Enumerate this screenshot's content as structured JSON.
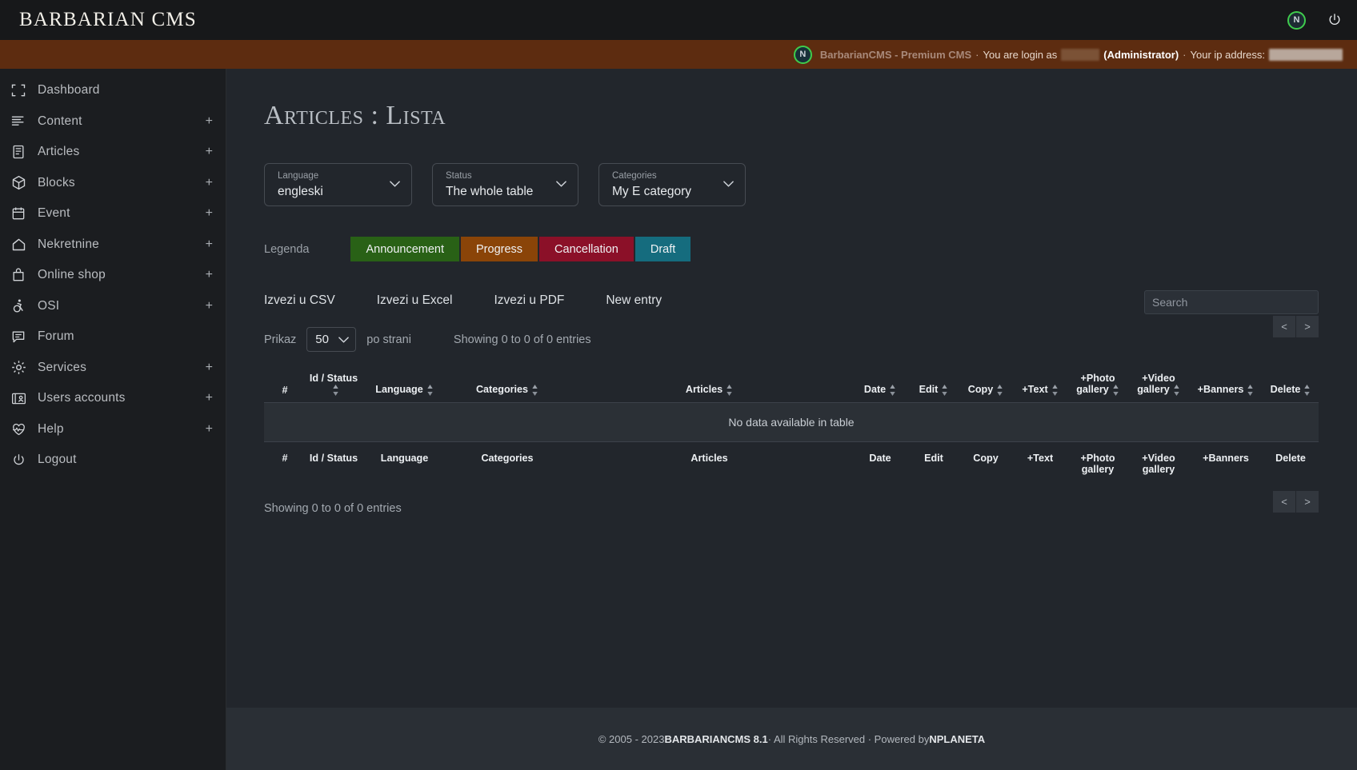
{
  "topbar": {
    "logo": "BARBARIAN CMS",
    "notification_badge": "N",
    "notification_icon_name": "notification-badge-icon",
    "power_icon_name": "power-icon"
  },
  "noticebar": {
    "badge": "N",
    "brand": "BarbarianCMS - Premium CMS",
    "sep1": "·",
    "login_text": "You are login as",
    "username_redacted": "",
    "role": "(Administrator)",
    "sep2": "·",
    "ip_text": "Your ip address:",
    "ip_redacted": "",
    "background_color": "#5d2c10"
  },
  "sidebar": {
    "items": [
      {
        "label": "Dashboard",
        "icon": "dashboard-icon",
        "expandable": false
      },
      {
        "label": "Content",
        "icon": "content-lines-icon",
        "expandable": true
      },
      {
        "label": "Articles",
        "icon": "article-doc-icon",
        "expandable": true
      },
      {
        "label": "Blocks",
        "icon": "cube-icon",
        "expandable": true
      },
      {
        "label": "Event",
        "icon": "calendar-icon",
        "expandable": true
      },
      {
        "label": "Nekretnine",
        "icon": "house-icon",
        "expandable": true
      },
      {
        "label": "Online shop",
        "icon": "shopping-bag-icon",
        "expandable": true
      },
      {
        "label": "OSI",
        "icon": "accessibility-icon",
        "expandable": true
      },
      {
        "label": "Forum",
        "icon": "chat-bubble-icon",
        "expandable": false
      },
      {
        "label": "Services",
        "icon": "gear-icon",
        "expandable": true
      },
      {
        "label": "Users accounts",
        "icon": "id-card-icon",
        "expandable": true
      },
      {
        "label": "Help",
        "icon": "heart-pulse-icon",
        "expandable": true
      },
      {
        "label": "Logout",
        "icon": "power-icon",
        "expandable": false
      }
    ],
    "expand_symbol": "+"
  },
  "main": {
    "page_title": "Articles : Lista",
    "filters": [
      {
        "label": "Language",
        "value": "engleski"
      },
      {
        "label": "Status",
        "value": "The whole table"
      },
      {
        "label": "Categories",
        "value": "My E category"
      }
    ],
    "legend": {
      "label": "Legenda",
      "items": [
        {
          "label": "Announcement",
          "color": "#296116"
        },
        {
          "label": "Progress",
          "color": "#8a4408"
        },
        {
          "label": "Cancellation",
          "color": "#8b1028"
        },
        {
          "label": "Draft",
          "color": "#156c7e"
        }
      ]
    },
    "export_buttons": [
      "Izvezi u CSV",
      "Izvezi u Excel",
      "Izvezi u PDF",
      "New entry"
    ],
    "search": {
      "placeholder": "Search",
      "value": ""
    },
    "table_controls": {
      "prikaz_label": "Prikaz",
      "page_size": "50",
      "po_strani_label": "po strani",
      "showing_text": "Showing 0 to 0 of 0 entries",
      "prev_label": "<",
      "next_label": ">"
    },
    "table": {
      "columns": [
        {
          "label": "#",
          "sortable": false
        },
        {
          "label": "Id / Status",
          "sortable": true
        },
        {
          "label": "Language",
          "sortable": true
        },
        {
          "label": "Categories",
          "sortable": true
        },
        {
          "label": "Articles",
          "sortable": true
        },
        {
          "label": "Date",
          "sortable": true
        },
        {
          "label": "Edit",
          "sortable": true
        },
        {
          "label": "Copy",
          "sortable": true
        },
        {
          "label": "+Text",
          "sortable": true
        },
        {
          "label": "+Photo gallery",
          "sortable": true
        },
        {
          "label": "+Video gallery",
          "sortable": true
        },
        {
          "label": "+Banners",
          "sortable": true
        },
        {
          "label": "Delete",
          "sortable": true
        }
      ],
      "empty_message": "No data available in table",
      "rows": []
    },
    "showing_bottom": "Showing 0 to 0 of 0 entries"
  },
  "footer": {
    "prefix": "© 2005 - 2023 ",
    "brand": "BARBARIANCMS 8.1",
    "middle": " · All Rights Reserved · Powered by ",
    "powered": "NPLANETA"
  }
}
